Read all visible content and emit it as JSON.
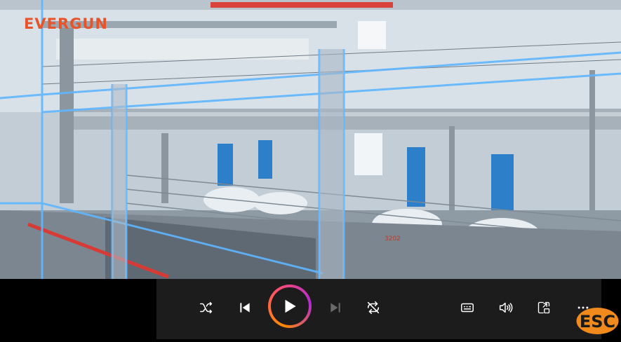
{
  "video": {
    "logo_text": "EVERGUN",
    "frame_number": "3202"
  },
  "controls": {
    "shuffle_icon": "shuffle-icon",
    "previous_icon": "skip-previous-icon",
    "play_icon": "play-icon",
    "next_icon": "skip-next-icon",
    "repeat_icon": "repeat-icon",
    "captions_icon": "captions-icon",
    "volume_icon": "volume-icon",
    "miniplayer_icon": "miniplayer-icon",
    "more_icon": "more-options-icon"
  },
  "badge": {
    "text": "ESC"
  },
  "colors": {
    "accent_orange": "#ff8a00",
    "accent_purple": "#b12bd1",
    "logo_red": "#e8542a",
    "neon_blue": "#5fb6ff"
  }
}
